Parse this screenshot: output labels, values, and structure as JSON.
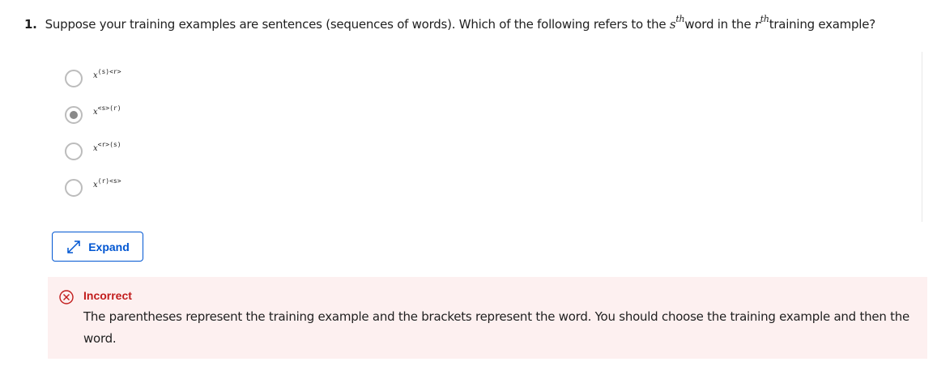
{
  "question": {
    "number": "1.",
    "text_before": "Suppose your training examples are sentences (sequences of words). Which of the following refers to the ",
    "var_s": "s",
    "sup_s": "th",
    "text_middle": "word in the ",
    "var_r": "r",
    "sup_r": "th",
    "text_after": "training example?"
  },
  "options": [
    {
      "base": "x",
      "sup": "(s)<r>",
      "selected": false
    },
    {
      "base": "x",
      "sup": "<s>(r)",
      "selected": true
    },
    {
      "base": "x",
      "sup": "<r>(s)",
      "selected": false
    },
    {
      "base": "x",
      "sup": "(r)<s>",
      "selected": false
    }
  ],
  "expand_button": {
    "label": "Expand",
    "icon": "expand-arrows-icon"
  },
  "feedback": {
    "status": "Incorrect",
    "icon": "x-circle-icon",
    "message": "The parentheses represent the training example and the brackets represent the word. You should choose the training example and then the word."
  },
  "colors": {
    "accent": "#0056d2",
    "error": "#c21d1d",
    "error_bg": "#fdf0f0"
  }
}
